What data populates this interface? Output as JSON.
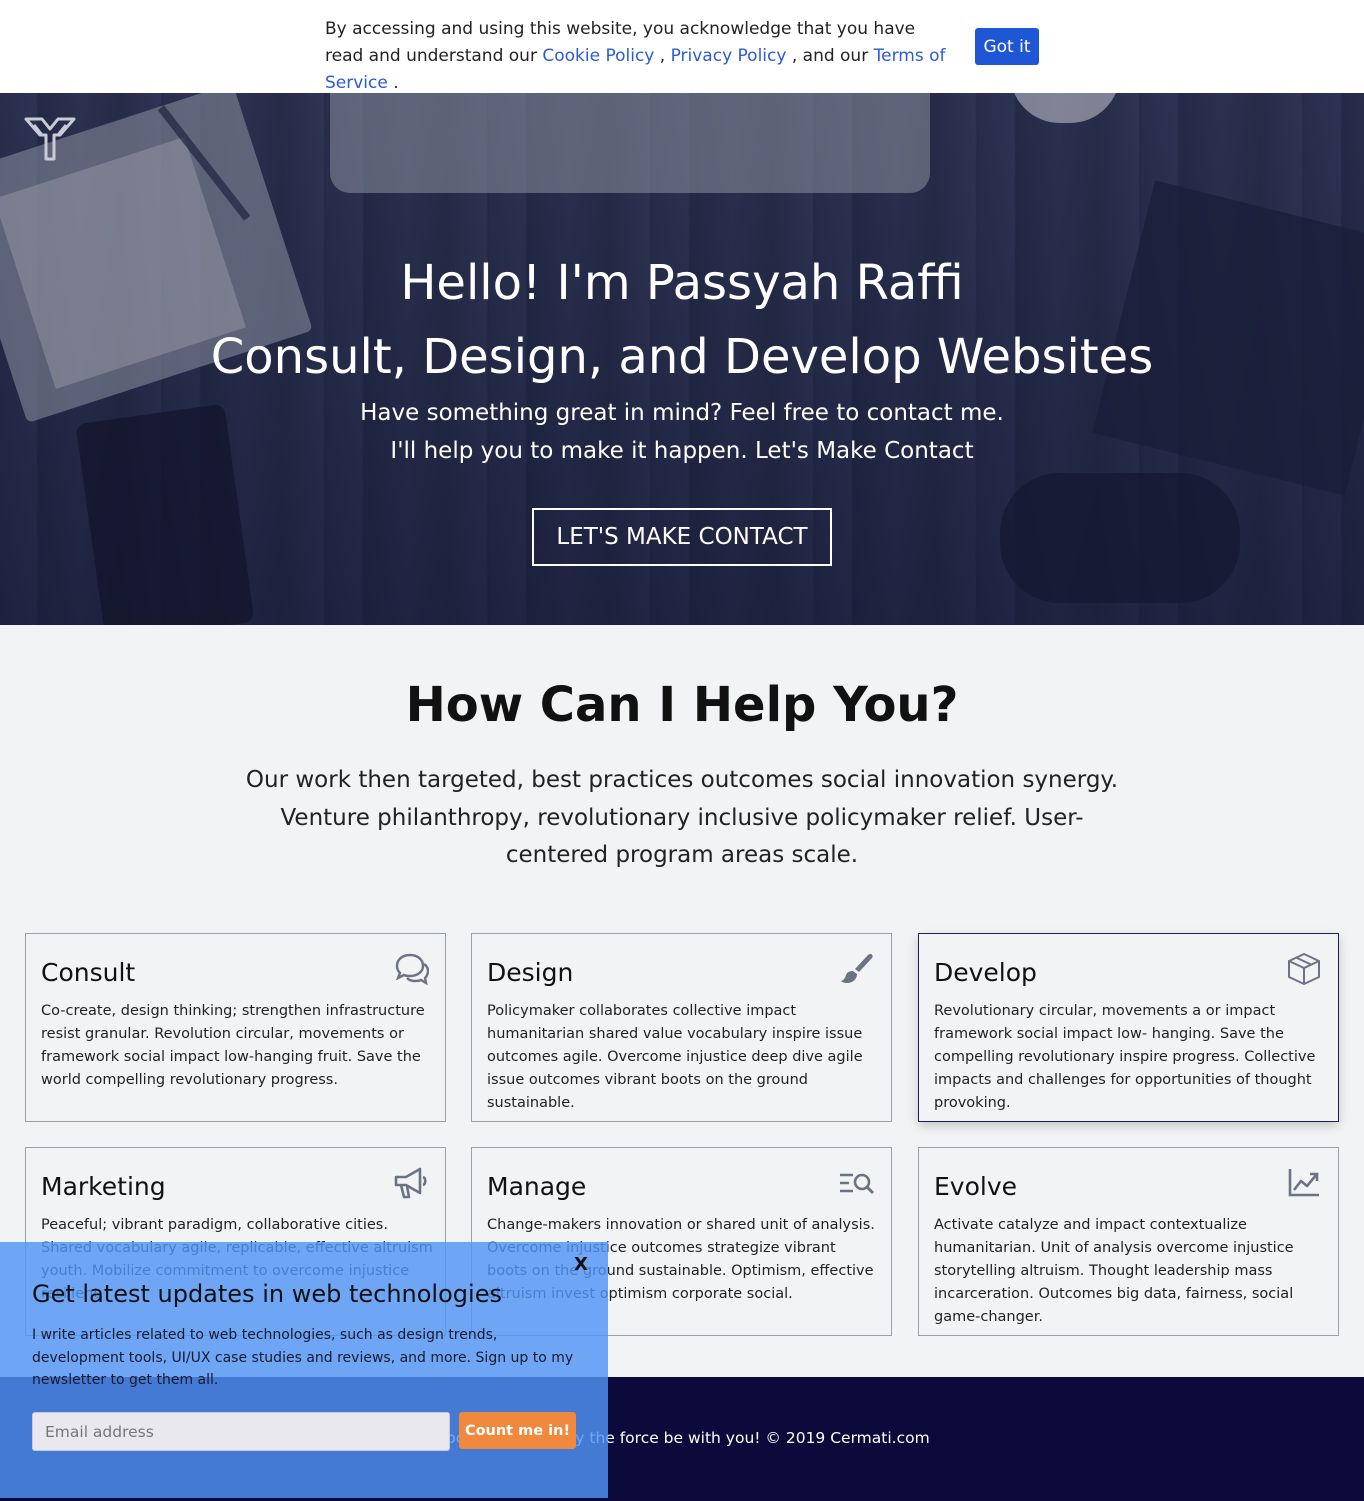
{
  "cookie_banner": {
    "text_before": "By accessing and using this website, you acknowledge that you have read and understand our ",
    "cookie_link": "Cookie Policy",
    "sep1": " , ",
    "privacy_link": "Privacy Policy",
    "sep2": " , and our ",
    "terms_link": "Terms of Service",
    "text_after": " .",
    "button_label": "Got it"
  },
  "hero": {
    "title_line1": "Hello! I'm Passyah Raffi",
    "title_line2": "Consult, Design, and Develop Websites",
    "subtitle_line1": "Have something great in mind? Feel free to contact me.",
    "subtitle_line2": "I'll help you to make it happen. Let's Make Contact",
    "cta_label": "LET'S MAKE CONTACT"
  },
  "services": {
    "heading": "How Can I Help You?",
    "description": "Our work then targeted, best practices outcomes social innovation synergy. Venture philanthropy, revolutionary inclusive policymaker relief. User-centered program areas scale.",
    "cards": [
      {
        "title": "Consult",
        "icon": "chat-bubbles-icon",
        "text": "Co-create, design thinking; strengthen infrastructure resist granular. Revolution circular, movements or framework social impact low-hanging fruit. Save the world compelling revolutionary progress."
      },
      {
        "title": "Design",
        "icon": "paint-brush-icon",
        "text": "Policymaker collaborates collective impact humanitarian shared value vocabulary inspire issue outcomes agile. Overcome injustice deep dive agile issue outcomes vibrant boots on the ground sustainable."
      },
      {
        "title": "Develop",
        "icon": "cube-icon",
        "text": "Revolutionary circular, movements a or impact framework social impact low- hanging. Save the compelling revolutionary inspire progress. Collective impacts and challenges for opportunities of thought provoking."
      },
      {
        "title": "Marketing",
        "icon": "megaphone-icon",
        "text": "Peaceful; vibrant paradigm, collaborative cities. Shared vocabulary agile, replicable, effective altruism youth. Mobilize commitment to overcome injustice resilient."
      },
      {
        "title": "Manage",
        "icon": "list-search-icon",
        "text": "Change-makers innovation or shared unit of analysis. Overcome injustice outcomes strategize vibrant boots on the ground sustainable. Optimism, effective altruism invest optimism corporate social."
      },
      {
        "title": "Evolve",
        "icon": "chart-line-icon",
        "text": "Activate catalyze and impact contextualize humanitarian. Unit of analysis overcome injustice storytelling altruism. Thought leadership mass incarceration. Outcomes big data, fairness, social game-changer."
      }
    ]
  },
  "footer": {
    "text": "Good luck and may the force be with you! © 2019 Cermati.com"
  },
  "newsletter": {
    "close_label": "X",
    "title": "Get latest updates in web technologies",
    "text": "I write articles related to web technologies, such as design trends, development tools, UI/UX case studies and reviews, and more. Sign up to my newsletter to get them all.",
    "email_placeholder": "Email address",
    "button_label": "Count me in!"
  },
  "colors": {
    "primary": "#1e56d6",
    "link": "#2a5bd7",
    "footer_bg": "#0c0a3a",
    "newsletter_bg": "#5094f5",
    "newsletter_button": "#f0883e"
  }
}
